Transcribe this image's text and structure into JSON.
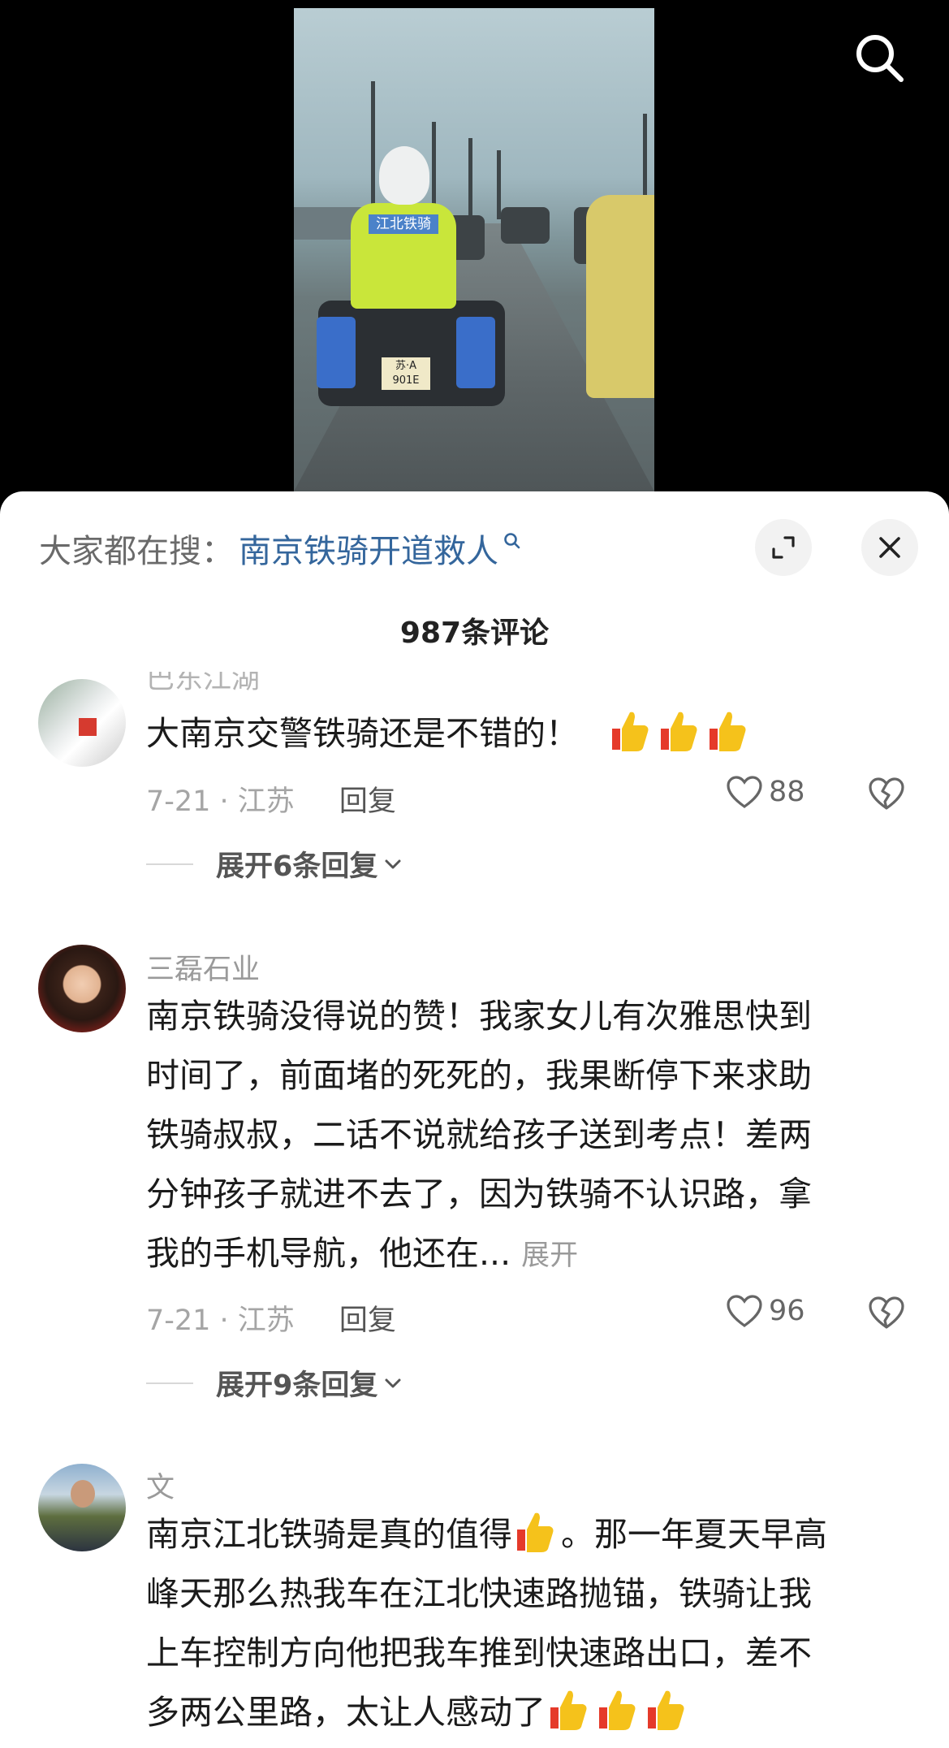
{
  "search_bar": {
    "prefix": "大家都在搜：",
    "query": "南京铁骑开道救人"
  },
  "video": {
    "plate_text": "苏·A 901E",
    "vest_text": "江北铁骑"
  },
  "comment_count": "987条评论",
  "comments": [
    {
      "username": "巴东江湖",
      "text": "大南京交警铁骑还是不错的！",
      "emoji_count": 3,
      "date_location": "7-21 · 江苏",
      "reply_label": "回复",
      "likes": "88",
      "expand_label": "展开6条回复"
    },
    {
      "username": "三磊石业",
      "text_lines": [
        "南京铁骑没得说的赞！我家女儿有次雅思快到",
        "时间了，前面堵的死死的，我果断停下来求助",
        "铁骑叔叔，二话不说就给孩子送到考点！差两",
        "分钟孩子就进不去了，因为铁骑不认识路，拿",
        "我的手机导航，他还在..."
      ],
      "more_label": "展开",
      "date_location": "7-21 · 江苏",
      "reply_label": "回复",
      "likes": "96",
      "expand_label": "展开9条回复"
    },
    {
      "username": "文",
      "line1_before": "南京江北铁骑是真的值得",
      "line1_after": "。那一年夏天早高",
      "lines_rest": [
        "峰天那么热我车在江北快速路抛锚，铁骑让我",
        "上车控制方向他把我车推到快速路出口，差不"
      ],
      "last_line": "多两公里路，太让人感动了"
    }
  ],
  "colors": {
    "query_link": "#34669c",
    "muted": "#9a9a9a",
    "sheet_bg": "#ffffff",
    "video_bg": "#000000",
    "thumb_yellow": "#f5c21b",
    "thumb_red": "#e53a2a"
  }
}
